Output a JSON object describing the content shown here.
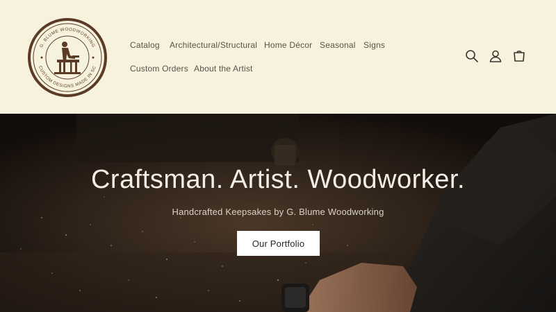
{
  "brand": {
    "ring_text_top": "G. BLUME WOODWORKING",
    "ring_text_bottom": "CUSTOM DESIGNS MADE IN SC"
  },
  "nav": {
    "items": [
      {
        "label": "Catalog"
      },
      {
        "label": "Architectural/Structural"
      },
      {
        "label": "Home Décor"
      },
      {
        "label": "Seasonal"
      },
      {
        "label": "Signs"
      },
      {
        "label": "Custom Orders"
      },
      {
        "label": "About the Artist"
      }
    ]
  },
  "header_icons": [
    "search-icon",
    "account-icon",
    "cart-icon"
  ],
  "hero": {
    "title": "Craftsman. Artist. Woodworker.",
    "subtitle": "Handcrafted Keepsakes by G. Blume Woodworking",
    "button_label": "Our Portfolio"
  },
  "colors": {
    "header_bg": "#f7f2dd",
    "logo_brown": "#5b3a26",
    "text_muted": "#5a5048",
    "hero_dark": "#1a1410"
  }
}
